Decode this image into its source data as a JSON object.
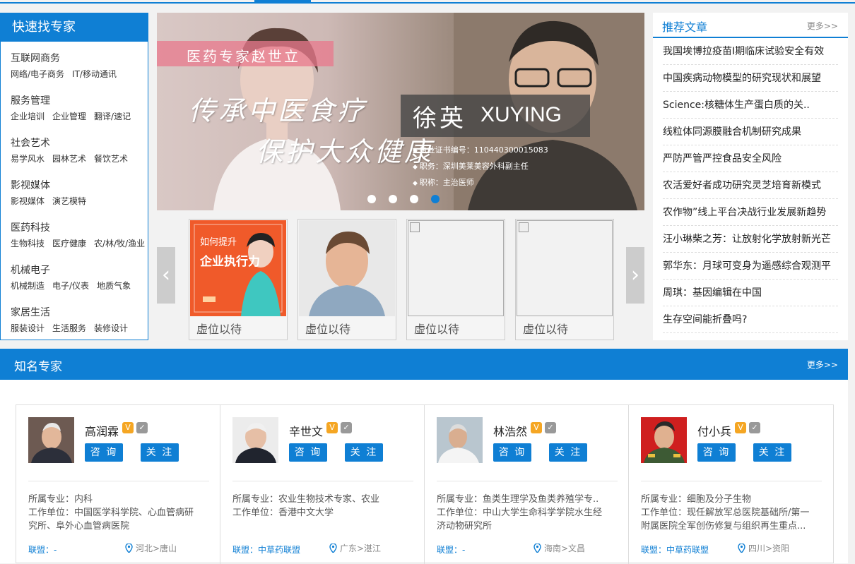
{
  "categories": {
    "title": "快速找专家",
    "groups": [
      {
        "name": "互联网商务",
        "subs": [
          "网络/电子商务",
          "IT/移动通讯"
        ]
      },
      {
        "name": "服务管理",
        "subs": [
          "企业培训",
          "企业管理",
          "翻译/速记"
        ]
      },
      {
        "name": "社会艺术",
        "subs": [
          "易学风水",
          "园林艺术",
          "餐饮艺术"
        ]
      },
      {
        "name": "影视媒体",
        "subs": [
          "影视媒体",
          "演艺模特"
        ]
      },
      {
        "name": "医药科技",
        "subs": [
          "生物科技",
          "医疗健康",
          "农/林/牧/渔业"
        ]
      },
      {
        "name": "机械电子",
        "subs": [
          "机械制造",
          "电子/仪表",
          "地质气象"
        ]
      },
      {
        "name": "家居生活",
        "subs": [
          "服装设计",
          "生活服务",
          "装修设计"
        ]
      }
    ]
  },
  "banner": {
    "ribbon": "医药专家赵世立",
    "slogan_line1": "传承中医食疗",
    "slogan_line2": "保护大众健康",
    "name_cn": "徐英",
    "name_en": "XUYING",
    "info": [
      "执业证书编号：110440300015083",
      "职务：深圳美莱美容外科副主任",
      "职称：主治医师"
    ],
    "active_slide": 4,
    "slide_count": 4
  },
  "thumbs": {
    "promo_line1": "如何提升",
    "promo_line2": "企业执行力",
    "items": [
      {
        "caption": "虚位以待"
      },
      {
        "caption": "虚位以待"
      },
      {
        "caption": "虚位以待"
      },
      {
        "caption": "虚位以待"
      }
    ],
    "prev_icon": "chevron-left-icon",
    "next_icon": "chevron-right-icon"
  },
  "articles": {
    "title": "推荐文章",
    "more": "更多>>",
    "items": [
      "我国埃博拉疫苗I期临床试验安全有效",
      "中国疾病动物模型的研究现状和展望",
      "Science:核糖体生产蛋白质的关..",
      "线粒体同源膜融合机制研究成果",
      "严防严管严控食品安全风险",
      "农活爱好者成功研究灵芝培育新模式",
      "农作物”线上平台决战行业发展新趋势",
      "汪小琳柴之芳：让放射化学放射新光芒",
      "郭华东：月球可变身为遥感综合观测平",
      "周琪：基因编辑在中国",
      "生存空间能折叠吗?"
    ]
  },
  "experts": {
    "title": "知名专家",
    "more": "更多>>",
    "consult_label": "咨 询",
    "follow_label": "关 注",
    "cards": [
      {
        "name": "高润霖",
        "major": "所属专业：内科",
        "unit_1": "工作单位：中国医学科学院、心血管病研",
        "unit_2": "究所、阜外心血管病医院",
        "league": "联盟：-",
        "location": "河北>唐山"
      },
      {
        "name": "辛世文",
        "major": "所属专业：农业生物技术专家、农业",
        "unit_1": "工作单位：香港中文大学",
        "unit_2": "",
        "league": "联盟：中草药联盟",
        "location": "广东>湛江"
      },
      {
        "name": "林浩然",
        "major": "所属专业：鱼类生理学及鱼类养殖学专..",
        "unit_1": "工作单位：中山大学生命科学学院水生经",
        "unit_2": "济动物研究所",
        "league": "联盟：-",
        "location": "海南>文昌"
      },
      {
        "name": "付小兵",
        "major": "所属专业：细胞及分子生物",
        "unit_1": "工作单位：现任解放军总医院基础所/第一",
        "unit_2": "附属医院全军创伤修复与组织再生重点...",
        "league": "联盟：中草药联盟",
        "location": "四川>资阳"
      }
    ]
  },
  "colors": {
    "brand": "#0f7fd4",
    "badge_vip": "#f5a623"
  }
}
